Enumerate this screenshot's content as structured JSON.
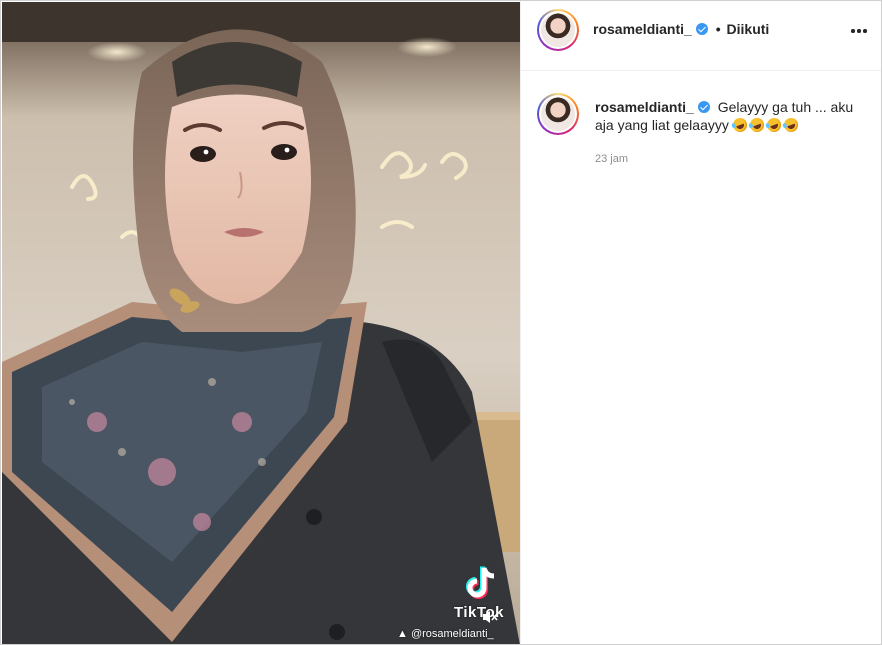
{
  "post": {
    "author": "rosameldianti_",
    "follow_separator": "•",
    "follow_state": "Diikuti"
  },
  "caption": {
    "author": "rosameldianti_",
    "text": "Gelayyy ga tuh ... aku aja yang liat gelaayyy",
    "emojis": [
      "rofl",
      "rofl",
      "rofl",
      "rofl"
    ],
    "time": "23 jam"
  },
  "video": {
    "watermark_brand": "TikTok",
    "watermark_handle": "@rosameldianti_",
    "muted": true
  },
  "colors": {
    "verified": "#3897f0",
    "secondary_text": "#8e8e8e",
    "primary_text": "#262626"
  }
}
